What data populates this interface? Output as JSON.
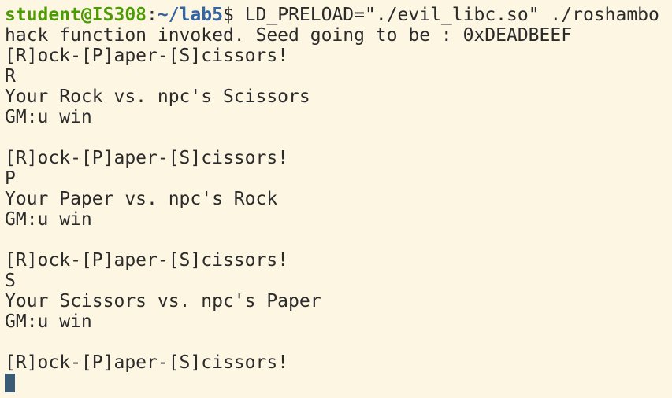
{
  "prompt": {
    "user_host": "student@IS308",
    "colon": ":",
    "path": "~/lab5",
    "dollar": "$",
    "command": " LD_PRELOAD=\"./evil_libc.so\" ./roshambo"
  },
  "output_lines": [
    "hack function invoked. Seed going to be : 0xDEADBEEF",
    "[R]ock-[P]aper-[S]cissors!",
    "R",
    "Your Rock vs. npc's Scissors",
    "GM:u win",
    "",
    "[R]ock-[P]aper-[S]cissors!",
    "P",
    "Your Paper vs. npc's Rock",
    "GM:u win",
    "",
    "[R]ock-[P]aper-[S]cissors!",
    "S",
    "Your Scissors vs. npc's Paper",
    "GM:u win",
    "",
    "[R]ock-[P]aper-[S]cissors!"
  ],
  "colors": {
    "background": "#fdf6e3",
    "text": "#2b2b2b",
    "user_host": "#4e9a06",
    "path": "#3465a4",
    "cursor": "#3a5a75"
  }
}
